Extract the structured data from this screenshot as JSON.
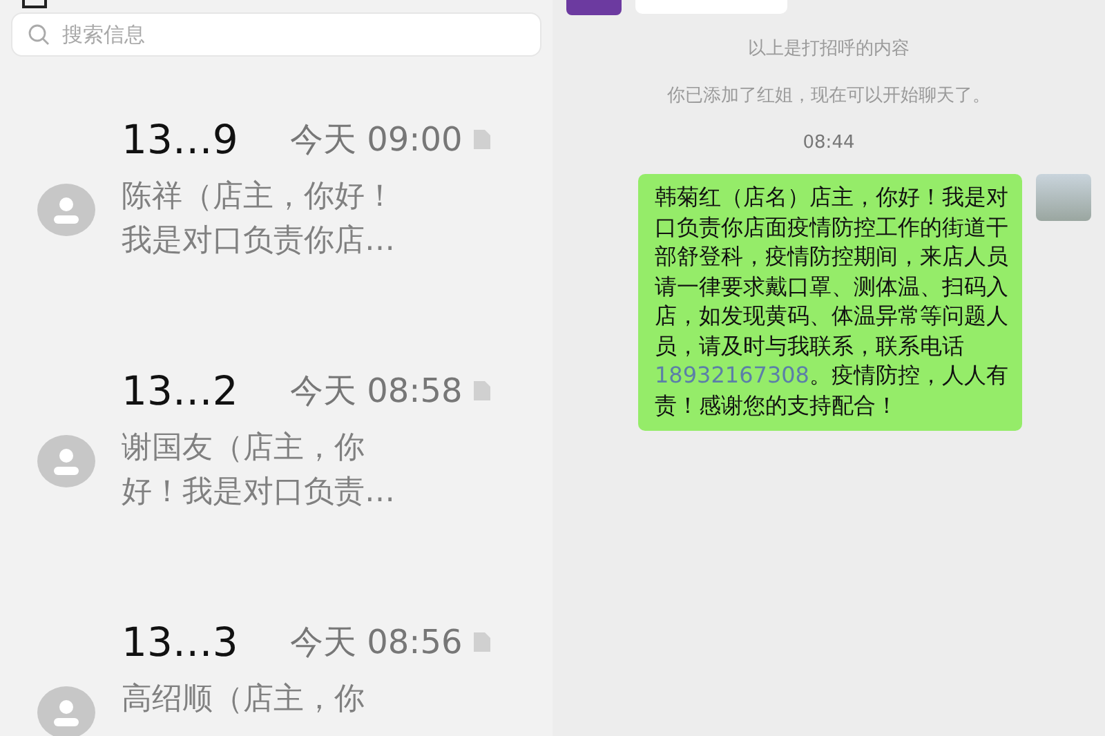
{
  "inbox": {
    "search": {
      "placeholder": "搜索信息"
    },
    "messages": [
      {
        "sender": "13…9",
        "time": "今天 09:00",
        "preview": [
          "陈祥（店主，你好！",
          "我是对口负责你店…"
        ]
      },
      {
        "sender": "13…2",
        "time": "今天 08:58",
        "preview": [
          "谢国友（店主，你",
          "好！我是对口负责…"
        ]
      },
      {
        "sender": "13…3",
        "time": "今天 08:56",
        "preview": [
          "高绍顺（店主，你"
        ]
      }
    ]
  },
  "chat": {
    "notices": [
      {
        "kind": "system",
        "text": "以上是打招呼的内容"
      },
      {
        "kind": "system",
        "text": "你已添加了红姐，现在可以开始聊天了。"
      },
      {
        "kind": "time",
        "text": "08:44"
      }
    ],
    "message": {
      "parts": [
        {
          "kind": "text",
          "text": "韩菊红（店名）店主，你好！我是对口负责你店面疫情防控工作的街道干部舒登科，疫情防控期间，来店人员请一律要求戴口罩、测体温、扫码入店，如发现黄码、体温异常等问题人员，请及时与我联系，联系电话 "
        },
        {
          "kind": "phone",
          "text": "18932167308"
        },
        {
          "kind": "text",
          "text": "。疫情防控，人人有责！感谢您的支持配合！"
        }
      ]
    }
  }
}
